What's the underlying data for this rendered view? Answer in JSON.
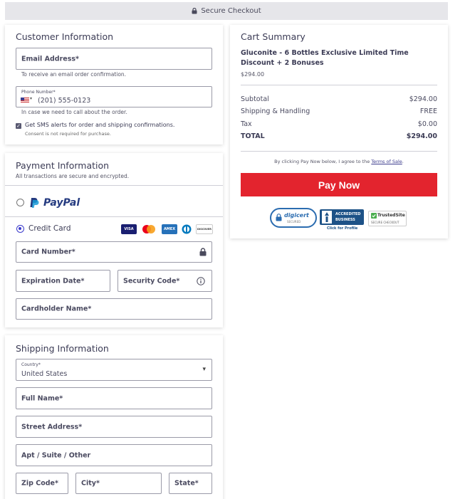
{
  "topbar": {
    "label": "Secure Checkout"
  },
  "customer": {
    "title": "Customer Information",
    "email_label": "Email Address*",
    "email_hint": "To receive an email order confirmation.",
    "phone_small_label": "Phone Number*",
    "phone_placeholder": "(201) 555-0123",
    "phone_hint": "In case we need to call about the order.",
    "sms_label": "Get SMS alerts for order and shipping confirmations.",
    "sms_sub": "Consent is not required for purchase."
  },
  "payment": {
    "title": "Payment Information",
    "subtitle": "All transactions are secure and encrypted.",
    "paypal_label": "PayPal",
    "credit_label": "Credit Card",
    "card_icons": [
      "VISA",
      "AMEX",
      "DISCOVER"
    ],
    "card_number_label": "Card Number*",
    "expiration_label": "Expiration Date*",
    "security_label": "Security Code*",
    "cardholder_label": "Cardholder Name*"
  },
  "shipping": {
    "title": "Shipping Information",
    "country_small_label": "Country*",
    "country_value": "United States",
    "fullname_label": "Full Name*",
    "street_label": "Street Address*",
    "apt_label": "Apt / Suite / Other",
    "zip_label": "Zip Code*",
    "city_label": "City*",
    "state_label": "State*"
  },
  "cart": {
    "title": "Cart Summary",
    "product_name": "Gluconite - 6 Bottles Exclusive Limited Time Discount + 2 Bonuses",
    "product_price": "$294.00",
    "subtotal_label": "Subtotal",
    "subtotal_value": "$294.00",
    "shipping_label": "Shipping & Handling",
    "shipping_value": "FREE",
    "tax_label": "Tax",
    "tax_value": "$0.00",
    "total_label": "TOTAL",
    "total_value": "$294.00",
    "terms_prefix": "By clicking Pay Now below, I agree to the",
    "terms_link": "Terms of Sale",
    "terms_suffix": ".",
    "pay_button": "Pay Now",
    "badges": {
      "digicert": "digicert",
      "digicert_sub": "SECURED",
      "bbb_line1": "ACCREDITED",
      "bbb_line2": "BUSINESS",
      "bbb_sub": "Click for Profile",
      "trusted": "TrustedSite",
      "trusted_sub": "SECURE CHECKOUT"
    }
  },
  "colors": {
    "accent": "#3b3bcc",
    "pay_button": "#e3242e",
    "paypal_dark": "#253b80",
    "paypal_light": "#179bd7"
  }
}
